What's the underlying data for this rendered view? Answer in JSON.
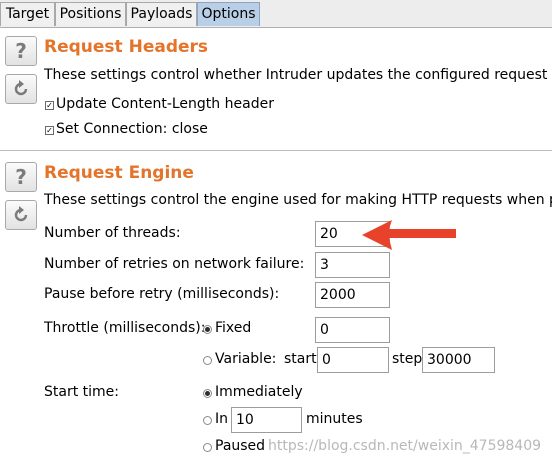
{
  "tabs": [
    {
      "label": "Target",
      "active": false
    },
    {
      "label": "Positions",
      "active": false
    },
    {
      "label": "Payloads",
      "active": false
    },
    {
      "label": "Options",
      "active": true
    }
  ],
  "request_headers": {
    "help_icon": "question-mark-icon",
    "restore_icon": "restore-defaults-icon",
    "title": "Request Headers",
    "description": "These settings control whether Intruder updates the configured request he",
    "options": [
      {
        "label": "Update Content-Length header",
        "checked": true
      },
      {
        "label": "Set Connection: close",
        "checked": true
      }
    ]
  },
  "request_engine": {
    "help_icon": "question-mark-icon",
    "restore_icon": "restore-defaults-icon",
    "title": "Request Engine",
    "description": "These settings control the engine used for making HTTP requests when p",
    "threads_label": "Number of threads:",
    "threads_value": "20",
    "retries_label": "Number of retries on network failure:",
    "retries_value": "3",
    "pause_label": "Pause before retry (milliseconds):",
    "pause_value": "2000",
    "throttle": {
      "label": "Throttle (milliseconds):",
      "fixed_label": "Fixed",
      "fixed_selected": true,
      "fixed_value": "0",
      "variable_label": "Variable:",
      "variable_selected": false,
      "start_label": "start",
      "start_value": "0",
      "step_label": "step",
      "step_value": "30000"
    },
    "start_time": {
      "label": "Start time:",
      "immediately_label": "Immediately",
      "immediately_selected": true,
      "in_label": "In",
      "in_selected": false,
      "in_value": "10",
      "minutes_label": "minutes",
      "paused_label": "Paused",
      "paused_selected": false
    }
  },
  "annotation_arrow_color": "#e8432a",
  "heading_color": "#e5742b",
  "watermark": "https://blog.csdn.net/weixin_47598409"
}
